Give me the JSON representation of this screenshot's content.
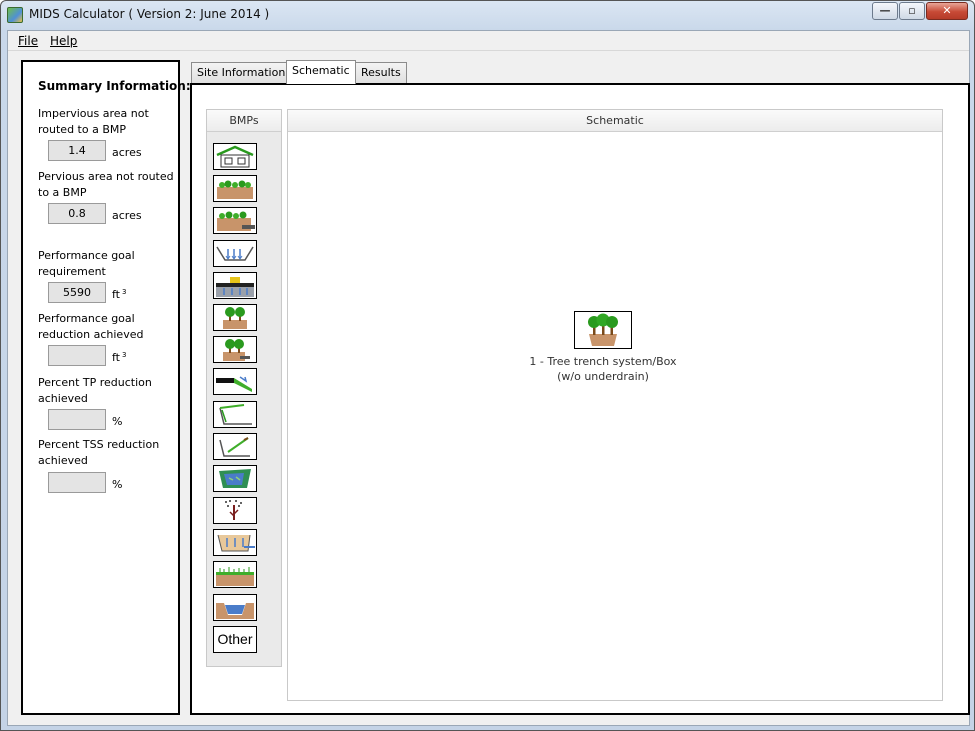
{
  "window": {
    "title": "MIDS Calculator ( Version 2: June 2014 )",
    "minimize_glyph": "—",
    "maximize_glyph": "▫",
    "close_glyph": "✕"
  },
  "menu": {
    "file": "File",
    "help": "Help"
  },
  "summary": {
    "title": "Summary Information:",
    "impervious_label": "Impervious area not routed to a BMP",
    "impervious_value": "1.4",
    "impervious_unit": "acres",
    "pervious_label": "Pervious area not routed to a BMP",
    "pervious_value": "0.8",
    "pervious_unit": "acres",
    "goal_req_label": "Performance goal requirement",
    "goal_req_value": "5590",
    "goal_req_unit": "ft",
    "goal_ach_label": "Performance goal reduction achieved",
    "goal_ach_value": "",
    "goal_ach_unit": "ft",
    "unit_exp": "3",
    "tp_label": "Percent TP reduction achieved",
    "tp_value": "",
    "tp_unit": "%",
    "tss_label": "Percent TSS reduction achieved",
    "tss_value": "",
    "tss_unit": "%"
  },
  "tabs": {
    "site": "Site Information",
    "schematic": "Schematic",
    "results": "Results"
  },
  "bmp_panel": {
    "header": "BMPs",
    "icons": [
      "green-roof-icon",
      "bioretention-icon",
      "bioretention-underdrain-icon",
      "infiltration-basin-icon",
      "permeable-pavement-icon",
      "tree-trench-icon",
      "tree-trench-underdrain-icon",
      "swale-side-slope-icon",
      "swale-main-channel-icon",
      "swale-underdrain-icon",
      "constructed-wetland-icon",
      "stormwater-reuse-icon",
      "sand-filter-icon",
      "vegetated-filter-strip-icon",
      "wet-pond-icon"
    ],
    "other": "Other"
  },
  "schematic": {
    "header": "Schematic",
    "node_icon": "tree-trench-icon",
    "node_line1": "1 - Tree trench system/Box",
    "node_line2": "(w/o underdrain)"
  },
  "colors": {
    "foliage": "#2a9a1e",
    "soil": "#c8946a",
    "water": "#4a7cc9",
    "close_red": "#c74a36"
  }
}
